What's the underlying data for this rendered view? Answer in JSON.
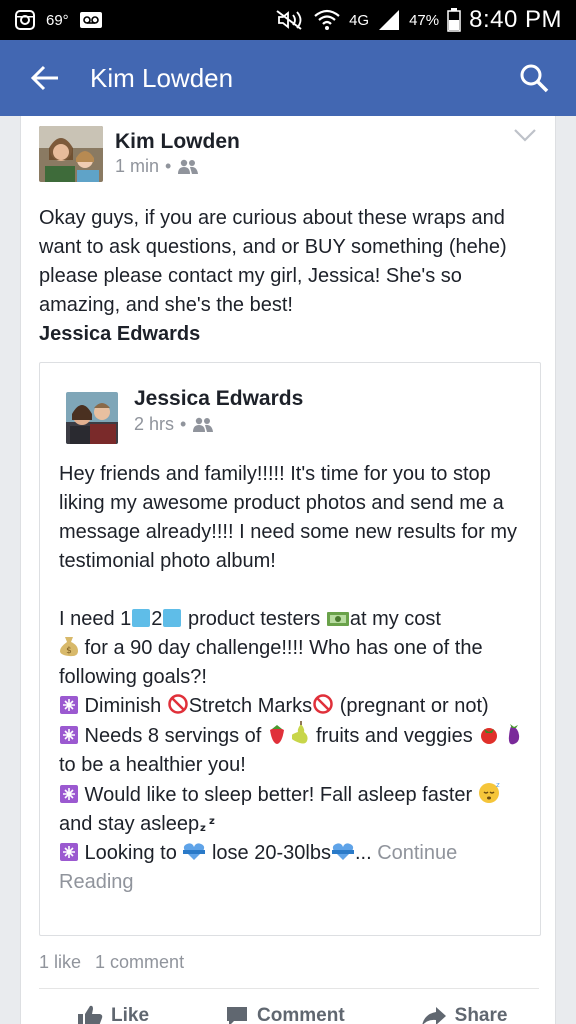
{
  "status_bar": {
    "temperature": "69°",
    "network": "4G",
    "battery": "47%",
    "time": "8:40 PM",
    "icons": [
      "instagram-icon",
      "voicemail-icon",
      "mute-icon",
      "wifi-icon",
      "signal-icon",
      "battery-icon"
    ]
  },
  "app_bar": {
    "title": "Kim Lowden",
    "back_icon": "arrow-left-icon",
    "search_icon": "search-icon",
    "color": "#4267b2"
  },
  "post": {
    "author": "Kim Lowden",
    "time": "1 min",
    "privacy_icon": "friends-icon",
    "text": "Okay guys,  if you are curious about these wraps and want to ask questions,  and or  BUY something (hehe) please please contact my girl, Jessica!  She's so amazing,  and she's the best!",
    "tag": "Jessica Edwards",
    "shared": {
      "author": "Jessica Edwards",
      "time": "2 hrs",
      "para1": "Hey friends and family!!!!! It's time for you to stop liking my awesome product photos and send me a message already!!!! I need some new results for my testimonial photo album!",
      "l1a": "I need 1",
      "l1b": "2",
      "l1c": " product testers ",
      "l1d": "at my cost",
      "l2": " for a 90 day challenge!!!! Who has one of the following goals?!",
      "l3a": " Diminish ",
      "l3b": "Stretch Marks",
      "l3c": " (pregnant or not)",
      "l4a": " Needs 8 servings of ",
      "l4b": " fruits and veggies ",
      "l4c": " to be a healthier you!",
      "l5": " Would like to sleep better! Fall asleep faster ",
      "l5b": " and stay asleep",
      "l6a": " Looking to ",
      "l6b": " lose 20-30lbs",
      "l6c": "... ",
      "continue": "Continue Reading"
    },
    "likes": "1 like",
    "comments": "1 comment",
    "actions": {
      "like": "Like",
      "comment": "Comment",
      "share": "Share"
    }
  }
}
